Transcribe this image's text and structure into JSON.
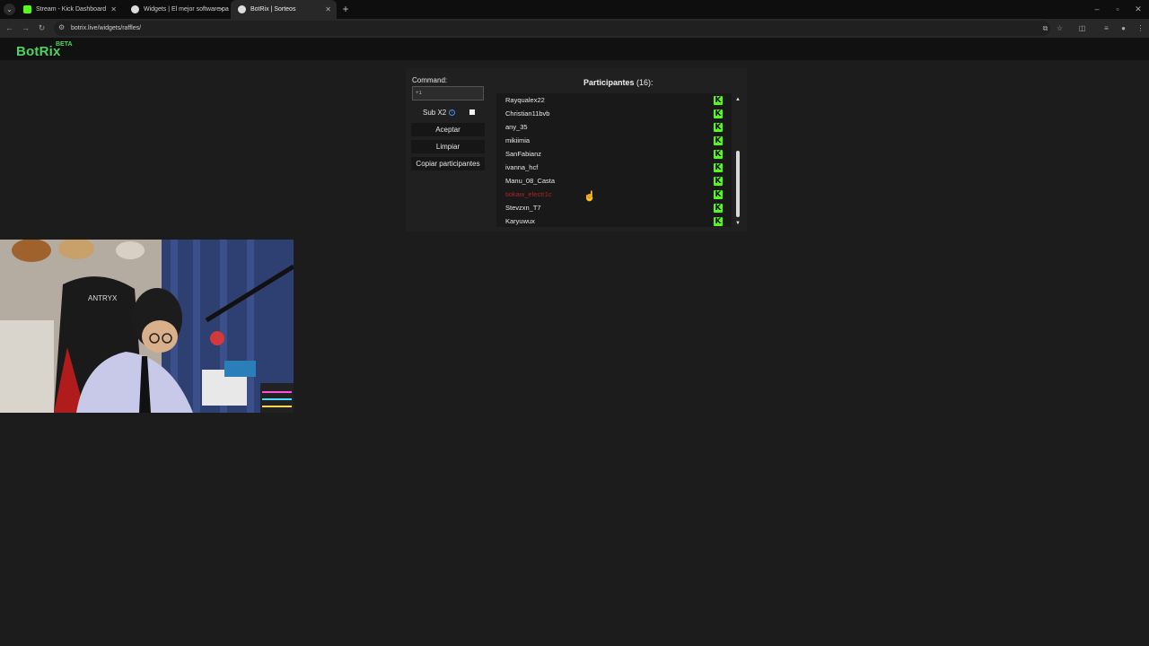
{
  "browser": {
    "tabs": [
      {
        "title": "Stream - Kick Dashboard",
        "favicon_color": "#53fc18"
      },
      {
        "title": "Widgets | El mejor software pa",
        "favicon_color": "#dddddd"
      },
      {
        "title": "BotRix | Sorteos",
        "favicon_color": "#dddddd"
      }
    ],
    "url": "botrix.live/widgets/raffles/"
  },
  "app": {
    "logo": "BotRix",
    "logo_badge": "BETA",
    "accent_color": "#4fd35f"
  },
  "raffle": {
    "command_label": "Command:",
    "command_value": "+1",
    "sub_label": "Sub X2",
    "accept_label": "Aceptar",
    "clear_label": "Limpiar",
    "copy_label": "Copiar participantes",
    "participants_title": "Participantes",
    "participants_count": "(16):",
    "participants": [
      {
        "name": "Rayqualex22",
        "highlight": false
      },
      {
        "name": "Christian11bvb",
        "highlight": false
      },
      {
        "name": "any_35",
        "highlight": false
      },
      {
        "name": "mikiimia",
        "highlight": false
      },
      {
        "name": "SanFabianz",
        "highlight": false
      },
      {
        "name": "ivanna_hcf",
        "highlight": false
      },
      {
        "name": "Manu_08_Casta",
        "highlight": false
      },
      {
        "name": "tiokaw_electr1c",
        "highlight": true
      },
      {
        "name": "Stevzxn_T7",
        "highlight": false
      },
      {
        "name": "Karyuwux",
        "highlight": false
      }
    ]
  },
  "webcam": {
    "chair_brand": "ANTRYX"
  }
}
